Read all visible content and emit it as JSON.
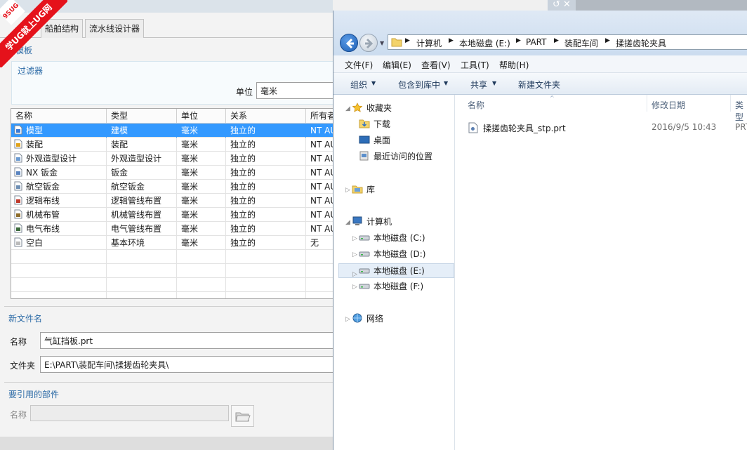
{
  "watermark": {
    "brand": "9SUG",
    "slogan": "学UG就上UG网"
  },
  "nx_dialog": {
    "tabs": [
      "船舶结构",
      "流水线设计器"
    ],
    "template_section": "模板",
    "filter_title": "过滤器",
    "unit_label": "单位",
    "unit_value": "毫米",
    "columns": [
      "名称",
      "类型",
      "单位",
      "关系",
      "所有者"
    ],
    "rows": [
      {
        "name": "模型",
        "type": "建模",
        "unit": "毫米",
        "relation": "独立的",
        "owner": "NT AU",
        "icon": "model-icon",
        "selected": true
      },
      {
        "name": "装配",
        "type": "装配",
        "unit": "毫米",
        "relation": "独立的",
        "owner": "NT AU",
        "icon": "assembly-icon",
        "selected": false
      },
      {
        "name": "外观造型设计",
        "type": "外观造型设计",
        "unit": "毫米",
        "relation": "独立的",
        "owner": "NT AU",
        "icon": "shape-studio-icon",
        "selected": false
      },
      {
        "name": "NX 钣金",
        "type": "钣金",
        "unit": "毫米",
        "relation": "独立的",
        "owner": "NT AU",
        "icon": "sheet-metal-icon",
        "selected": false
      },
      {
        "name": "航空钣金",
        "type": "航空钣金",
        "unit": "毫米",
        "relation": "独立的",
        "owner": "NT AU",
        "icon": "aero-sheet-metal-icon",
        "selected": false
      },
      {
        "name": "逻辑布线",
        "type": "逻辑管线布置",
        "unit": "毫米",
        "relation": "独立的",
        "owner": "NT AU",
        "icon": "logical-routing-icon",
        "selected": false
      },
      {
        "name": "机械布管",
        "type": "机械管线布置",
        "unit": "毫米",
        "relation": "独立的",
        "owner": "NT AU",
        "icon": "mechanical-routing-icon",
        "selected": false
      },
      {
        "name": "电气布线",
        "type": "电气管线布置",
        "unit": "毫米",
        "relation": "独立的",
        "owner": "NT AU",
        "icon": "electrical-routing-icon",
        "selected": false
      },
      {
        "name": "空白",
        "type": "基本环境",
        "unit": "毫米",
        "relation": "独立的",
        "owner": "无",
        "icon": "blank-icon",
        "selected": false
      }
    ],
    "new_file_section": "新文件名",
    "name_label": "名称",
    "name_value": "气缸挡板.prt",
    "folder_label": "文件夹",
    "folder_value": "E:\\PART\\装配车间\\揉搓齿轮夹具\\",
    "ref_section": "要引用的部件",
    "ref_name_label": "名称"
  },
  "explorer": {
    "breadcrumb": [
      "计算机",
      "本地磁盘 (E:)",
      "PART",
      "装配车间",
      "揉搓齿轮夹具"
    ],
    "menu": [
      "文件(F)",
      "编辑(E)",
      "查看(V)",
      "工具(T)",
      "帮助(H)"
    ],
    "toolbar": [
      "组织",
      "包含到库中",
      "共享",
      "新建文件夹"
    ],
    "nav": {
      "favorites": "收藏夹",
      "downloads": "下载",
      "desktop": "桌面",
      "recent": "最近访问的位置",
      "libraries": "库",
      "computer": "计算机",
      "drives": [
        "本地磁盘 (C:)",
        "本地磁盘 (D:)",
        "本地磁盘 (E:)",
        "本地磁盘 (F:)"
      ],
      "network": "网络"
    },
    "columns": [
      "名称",
      "修改日期",
      "类型"
    ],
    "file": {
      "name": "揉搓齿轮夹具_stp.prt",
      "date": "2016/9/5 10:43",
      "type": "PRT"
    }
  }
}
